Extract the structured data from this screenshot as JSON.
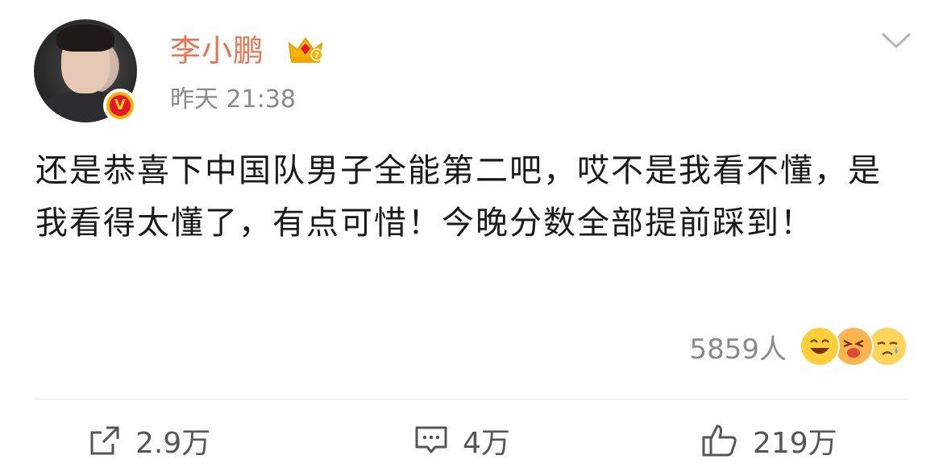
{
  "post": {
    "username": "李小鹏",
    "timestamp": "昨天 21:38",
    "text": "还是恭喜下中国队男子全能第二吧，哎不是我看不懂，是我看得太懂了，有点可惜！今晚分数全部提前踩到！",
    "reaction_count": "5859人",
    "reaction_emojis": [
      "laughing-emoji-icon",
      "crying-love-emoji-icon",
      "sad-tear-emoji-icon"
    ]
  },
  "actions": {
    "repost_count": "2.9万",
    "comment_count": "4万",
    "like_count": "219万"
  },
  "colors": {
    "username": "#eb7350",
    "secondary_text": "#8a8a8a",
    "body_text": "#1a1a1a"
  }
}
